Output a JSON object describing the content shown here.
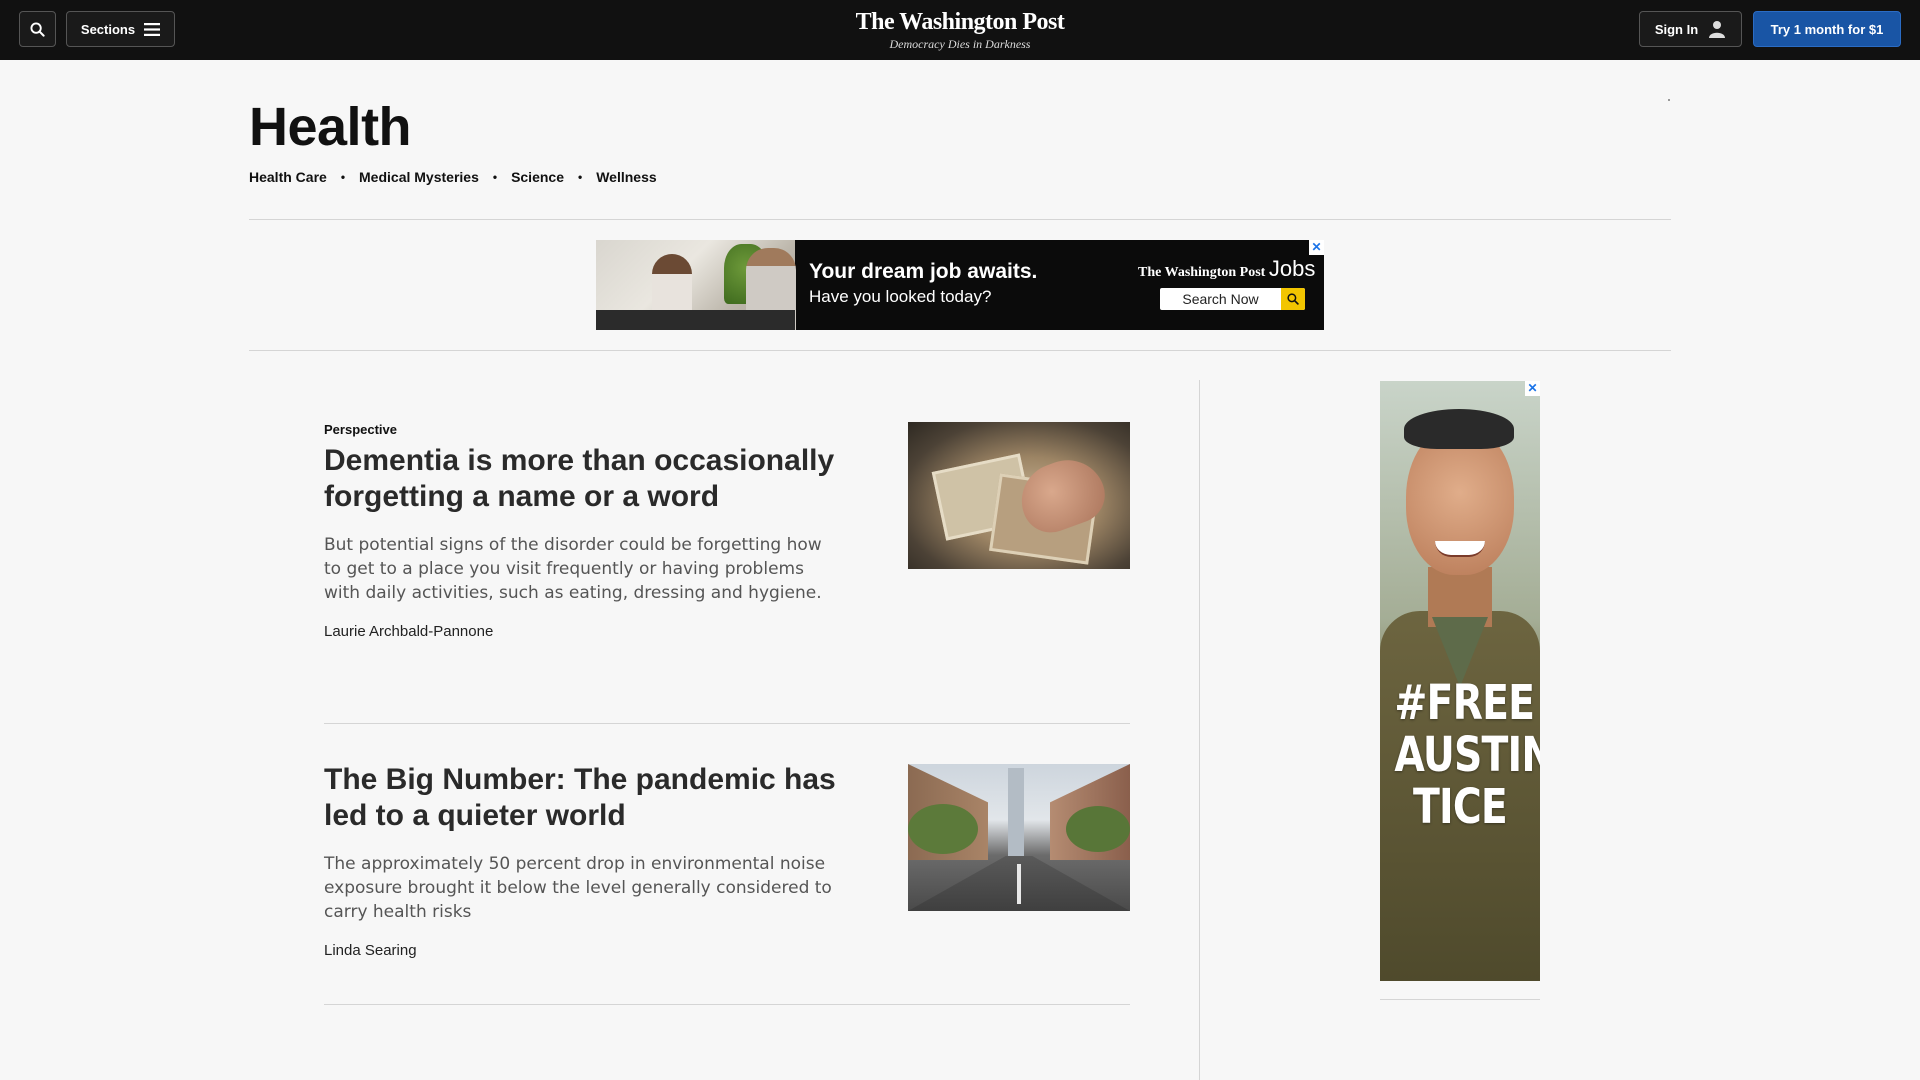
{
  "topbar": {
    "sections_label": "Sections",
    "logo_name": "The Washington Post",
    "logo_tagline": "Democracy Dies in Darkness",
    "signin_label": "Sign In",
    "subscribe_label": "Try 1 month for $1",
    "accent_color": "#1955a5"
  },
  "section": {
    "title": "Health",
    "subnav": [
      "Health Care",
      "Medical Mysteries",
      "Science",
      "Wellness"
    ]
  },
  "banner_ad": {
    "headline": "Your dream job awaits.",
    "subline": "Have you looked today?",
    "brand": "The Washington Post",
    "brand_suffix": "Jobs",
    "search_label": "Search Now",
    "close_symbol": "✕"
  },
  "articles": [
    {
      "kicker": "Perspective",
      "headline": "Dementia is more than occasionally forgetting a name or a word",
      "blurb": "But potential signs of the disorder could be forgetting how to get to a place you visit frequently or having problems with daily activities, such as eating, dressing and hygiene.",
      "byline": "Laurie Archbald-Pannone"
    },
    {
      "kicker": "",
      "headline": "The Big Number: The pandemic has led to a quieter world",
      "blurb": "The approximately 50 percent drop in environmental noise exposure brought it below the level generally considered to carry health risks",
      "byline": "Linda Searing"
    }
  ],
  "side_ad": {
    "text_line1": "#FREE",
    "text_line2": "AUSTIN",
    "text_line3": "TICE",
    "close_symbol": "✕"
  }
}
